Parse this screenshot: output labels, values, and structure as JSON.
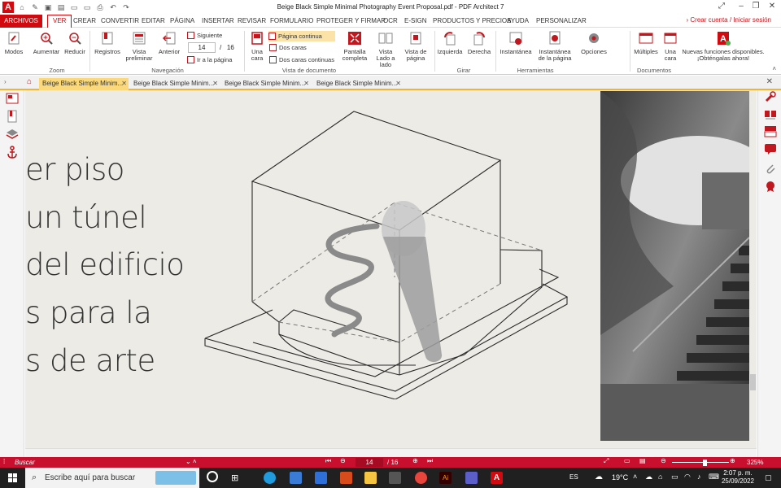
{
  "window": {
    "title": "Beige Black Simple Minimal Photography Event Proposal.pdf  -  PDF Architect 7"
  },
  "menu": {
    "items": [
      "ARCHIVOS",
      "VER",
      "CREAR",
      "CONVERTIR",
      "EDITAR",
      "PÁGINA",
      "INSERTAR",
      "REVISAR",
      "FORMULARIO",
      "PROTEGER Y FIRMAR",
      "OCR",
      "E-SIGN",
      "PRODUCTOS Y PRECIOS",
      "AYUDA",
      "PERSONALIZAR"
    ],
    "account_link": "› Crear cuenta / Iniciar sesión"
  },
  "ribbon": {
    "modos": "Modos",
    "aumentar": "Aumentar",
    "reducir": "Reducir",
    "zoom_group": "Zoom",
    "registros": "Registros",
    "vista_preliminar": "Vista preliminar",
    "anterior": "Anterior",
    "siguiente": "Siguiente",
    "page_value": "14",
    "page_sep": "/",
    "page_total": "16",
    "ir_a_pagina": "Ir a la página",
    "navegacion_group": "Navegación",
    "una_cara": "Una cara",
    "pagina_continua": "Página continua",
    "dos_caras": "Dos caras",
    "dos_caras_continuas": "Dos caras continuas",
    "pantalla_completa": "Pantalla completa",
    "vista_lado_a_lado": "Vista Lado a lado",
    "vista_de_pagina": "Vista de página",
    "vista_documento_group": "Vista de documento",
    "izquierda": "Izquierda",
    "derecha": "Derecha",
    "girar_group": "Girar",
    "instantanea": "Instantánea",
    "instantanea_pagina": "Instantánea de la página",
    "opciones": "Opciones",
    "herramientas_group": "Herramientas",
    "multiples": "Múltiples",
    "una_cara_doc": "Una cara",
    "nuevas_funciones": "Nuevas funciones disponibles. ¡Obténgalas ahora!",
    "documentos_group": "Documentos"
  },
  "tabs": [
    {
      "label": "Beige Black Simple Minim..."
    },
    {
      "label": "Beige Black Simple Minim..."
    },
    {
      "label": "Beige Black Simple Minim..."
    },
    {
      "label": "Beige Black Simple Minim..."
    }
  ],
  "document": {
    "lines": [
      "er piso",
      "un túnel",
      "del edificio",
      "s para la",
      "s de arte"
    ]
  },
  "statusbar": {
    "search": "Buscar",
    "page_value": "14",
    "page_total": "/ 16",
    "zoom": "325%"
  },
  "taskbar": {
    "search_placeholder": "Escribe aquí para buscar",
    "lang": "ES",
    "temperature": "19°C",
    "time": "2:07 p. m.",
    "date": "25/09/2022"
  },
  "colors": {
    "accent": "#d10a10",
    "tab_active": "#fbd97a",
    "page_bg": "#ecebe6",
    "status_bar": "#c8102e"
  }
}
